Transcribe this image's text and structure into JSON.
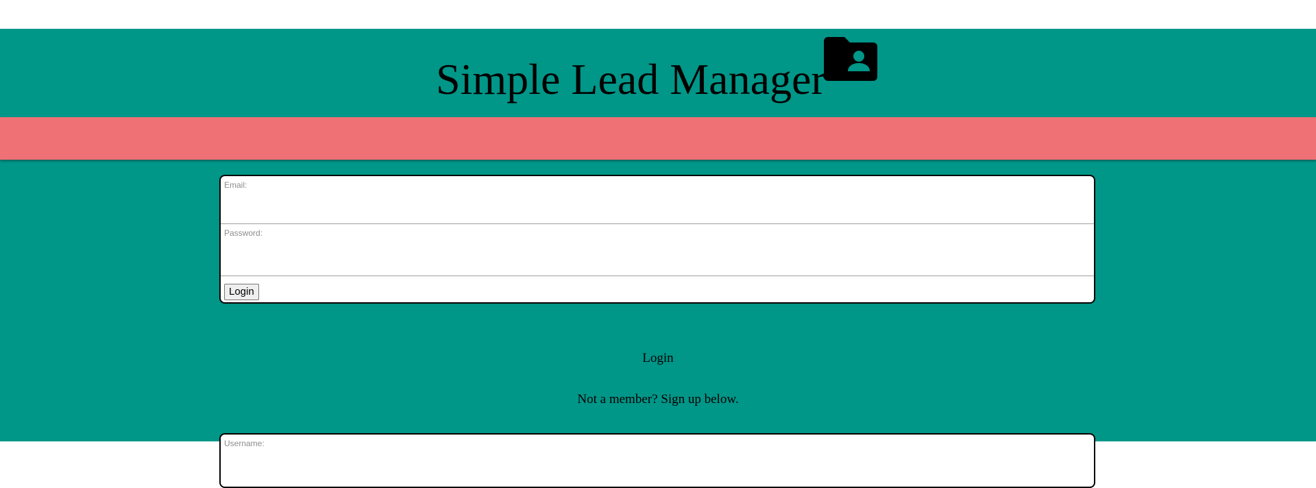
{
  "header": {
    "title": "Simple Lead Manager",
    "icon": "folder-user-icon"
  },
  "colors": {
    "teal": "#009688",
    "coral": "#ef7075"
  },
  "login_form": {
    "email_label": "Email:",
    "email_value": "",
    "password_label": "Password:",
    "password_value": "",
    "button_label": "Login"
  },
  "login_heading": "Login",
  "signup_prompt": "Not a member? Sign up below.",
  "signup_form": {
    "username_label": "Username:",
    "username_value": ""
  }
}
